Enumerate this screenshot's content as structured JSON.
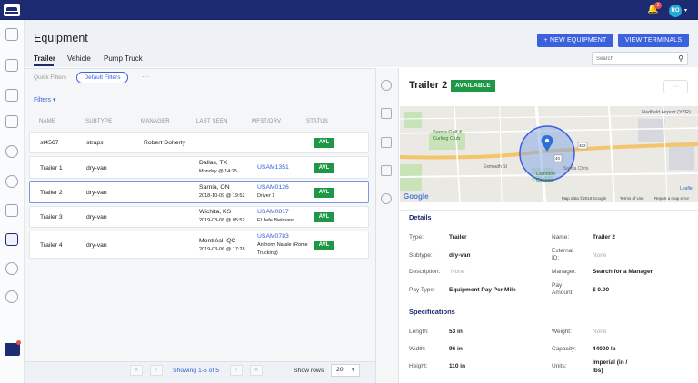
{
  "topbar": {
    "notifications_count": "2",
    "user_initials": "RO"
  },
  "page": {
    "title": "Equipment"
  },
  "tabs": [
    {
      "label": "Trailer"
    },
    {
      "label": "Vehicle"
    },
    {
      "label": "Pump Truck"
    }
  ],
  "actions": {
    "new_equipment": "+ NEW EQUIPMENT",
    "view_terminals": "VIEW TERMINALS"
  },
  "search": {
    "placeholder": "Search"
  },
  "filters": {
    "quick": "Quick Filters",
    "default": "Default Filters",
    "more": "···",
    "toggle": "Filters ▾"
  },
  "table": {
    "columns": [
      "NAME",
      "SUBTYPE",
      "MANAGER",
      "LAST SEEN",
      "MFST/DRV",
      "STATUS"
    ],
    "rows": [
      {
        "name": "st4567",
        "subtype": "straps",
        "manager": "Robert Doherty",
        "last_seen": "",
        "last_seen_date": "",
        "mfst": "",
        "driver": "",
        "driver2": "",
        "status": "AVL"
      },
      {
        "name": "Trailer 1",
        "subtype": "dry-van",
        "manager": "",
        "last_seen": "Dallas, TX",
        "last_seen_date": "Monday @ 14:25",
        "mfst": "USAM1351",
        "driver": "",
        "driver2": "",
        "status": "AVL"
      },
      {
        "name": "Trailer 2",
        "subtype": "dry-van",
        "manager": "",
        "last_seen": "Sarnia, ON",
        "last_seen_date": "2018-10-09 @ 19:52",
        "mfst": "USAM0126",
        "driver": "Driver 1",
        "driver2": "",
        "status": "AVL"
      },
      {
        "name": "Trailer 3",
        "subtype": "dry-van",
        "manager": "",
        "last_seen": "Wichita, KS",
        "last_seen_date": "2019-03-08 @ 05:52",
        "mfst": "USAM0817",
        "driver": "El Jefe Bielmann",
        "driver2": "",
        "status": "AVL"
      },
      {
        "name": "Trailer 4",
        "subtype": "dry-van",
        "manager": "",
        "last_seen": "Montréal, QC",
        "last_seen_date": "2019-03-06 @ 17:28",
        "mfst": "USAM0783",
        "driver": "Anthony Natale (Rome",
        "driver2": "Trucking)",
        "status": "AVL"
      }
    ]
  },
  "pagination": {
    "first": "«",
    "prev": "‹",
    "text": "Showing 1-5 of 5",
    "next": "›",
    "last": "»",
    "show_rows_label": "Show rows",
    "rows_value": "20"
  },
  "detail": {
    "title": "Trailer 2",
    "status": "AVAILABLE",
    "more": "···",
    "map": {
      "labels": [
        "Sarnia Golf &",
        "Curling Club",
        "Lambton",
        "College",
        "Sarnia Chris",
        "Hadfield Airport (YZR)",
        "Exmouth St",
        "Leaflet",
        "402",
        "40"
      ],
      "attribution": [
        "Map data ©2019 Google",
        "Terms of Use",
        "Report a map error"
      ],
      "google": "Google"
    },
    "details_heading": "Details",
    "details": [
      {
        "label": "Type:",
        "value": "Trailer"
      },
      {
        "label": "Name:",
        "value": "Trailer 2"
      },
      {
        "label": "Subtype:",
        "value": "dry-van"
      },
      {
        "label": "External",
        "label2": "ID:",
        "value": "None"
      },
      {
        "label": "Description:",
        "value": "None"
      },
      {
        "label": "Manager:",
        "value": "Search for a Manager"
      },
      {
        "label": "Pay Type:",
        "value": "Equipment Pay Per Mile"
      },
      {
        "label": "Pay",
        "label2": "Amount:",
        "value": "$ 0.00"
      }
    ],
    "specs_heading": "Specifications",
    "specs": [
      {
        "label": "Length:",
        "value": "53 in"
      },
      {
        "label": "Weight:",
        "value": "None"
      },
      {
        "label": "Width:",
        "value": "96 in"
      },
      {
        "label": "Capacity:",
        "value": "44000 lb"
      },
      {
        "label": "Height:",
        "value": "110 in"
      },
      {
        "label": "Units:",
        "value": "Imperial (in /",
        "value2": "lbs)"
      }
    ]
  },
  "colors": {
    "navy": "#1c2b72",
    "primary": "#3b61dd",
    "green": "#1e9847"
  }
}
